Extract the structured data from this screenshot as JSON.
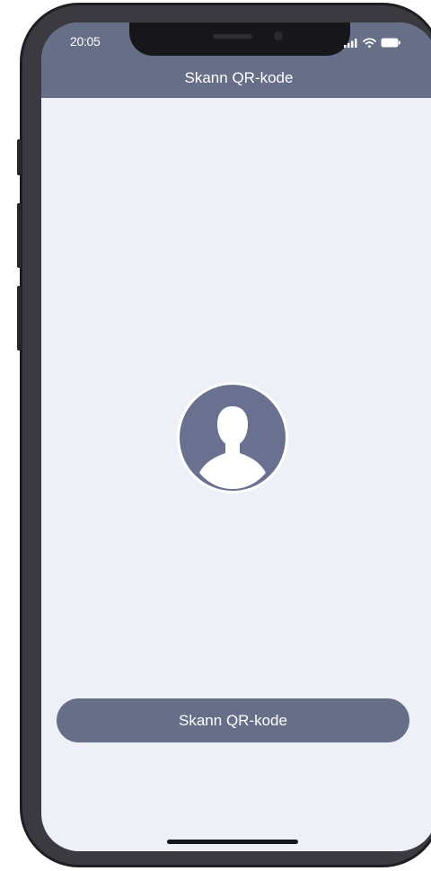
{
  "status_bar": {
    "time": "20:05",
    "icons": [
      "signal-icon",
      "wifi-icon",
      "battery-icon"
    ]
  },
  "header": {
    "title": "Skann QR-kode"
  },
  "profile": {
    "icon": "user-icon"
  },
  "actions": {
    "scan_label": "Skann QR-kode"
  },
  "colors": {
    "header_bg": "#676e88",
    "screen_bg": "#edf0f7",
    "button_bg": "#676e88",
    "avatar_bg": "#6a7090",
    "text_on_accent": "#ffffff"
  }
}
